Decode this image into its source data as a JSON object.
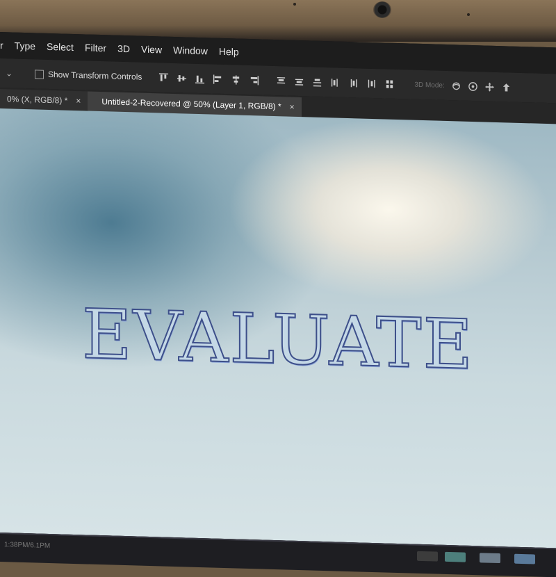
{
  "menu": {
    "items": [
      "r",
      "Type",
      "Select",
      "Filter",
      "3D",
      "View",
      "Window",
      "Help"
    ]
  },
  "options_bar": {
    "dropdown_chevron": "chevron-down-icon",
    "show_transform_label": "Show Transform Controls",
    "show_transform_checked": false,
    "label_3d_mode": "3D Mode:"
  },
  "tabs": {
    "inactive_label": "0% (X, RGB/8) *",
    "active_label": "Untitled-2-Recovered @ 50% (Layer 1, RGB/8) *",
    "close_glyph": "×"
  },
  "canvas": {
    "headline": "EVALUATE",
    "text_fill": "#c4d8e6",
    "text_stroke": "#3d4f8a"
  },
  "status_bar": {
    "partial_text": "1:38PM/6.1PM"
  }
}
